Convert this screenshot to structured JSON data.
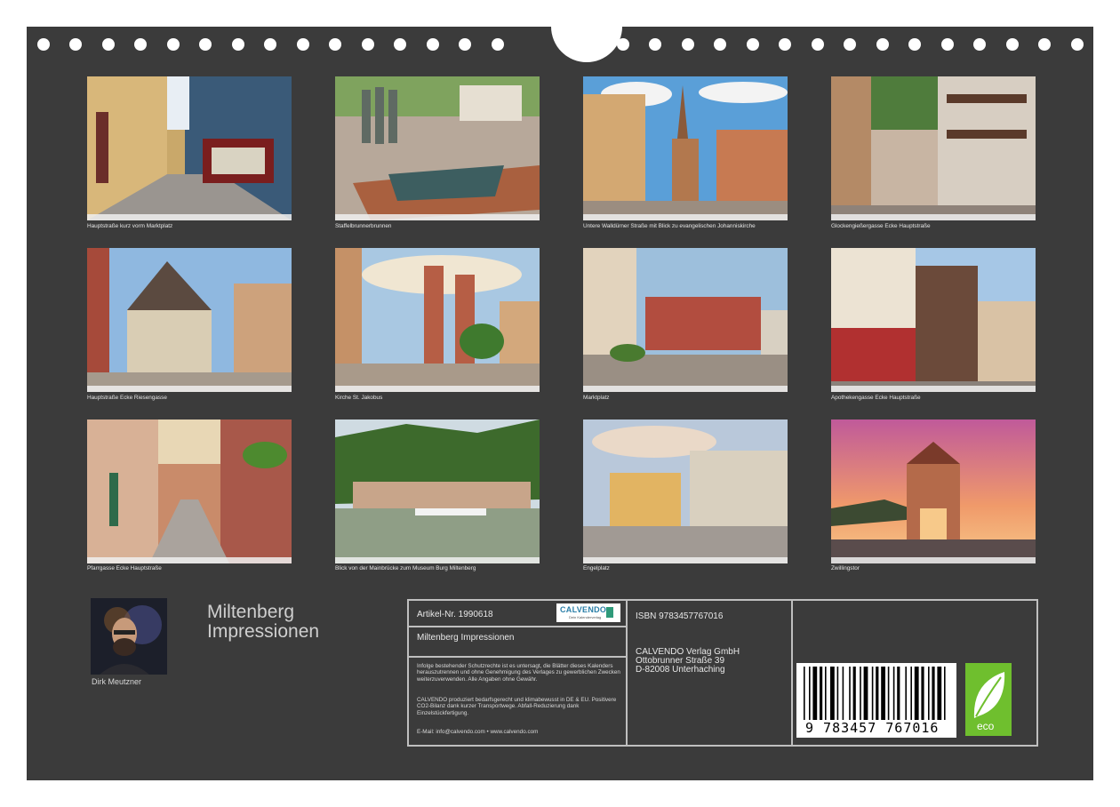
{
  "captions": [
    "Hauptstraße kurz vorm Marktplatz",
    "Staffelbrunnerbrunnen",
    "Untere Walldürner Straße mit Blick zu evangelischen Johanniskirche",
    "Glockengießergasse Ecke Hauptstraße",
    "Hauptstraße Ecke Riesengasse",
    "Kirche St. Jakobus",
    "Marktplatz",
    "Apothekengasse Ecke Hauptstraße",
    "Pfarrgasse Ecke Hauptstraße",
    "Blick von der Mainbrücke zum Museum Burg Miltenberg",
    "Engelplatz",
    "Zwillingstor"
  ],
  "title": {
    "line1": "Miltenberg",
    "line2": "Impressionen"
  },
  "author": "Dirk Meutzner",
  "info": {
    "article": "Artikel-Nr. 1990618",
    "logo": "CALVENDO",
    "logo_sub": "Dein Kalenderverlag",
    "product_name": "Miltenberg Impressionen",
    "legal1": "Infolge bestehender Schutzrechte ist es untersagt, die Blätter dieses Kalenders herauszutrennen und ohne Genehmigung des Verlages zu gewerblichen Zwecken weiterzuverwenden. Alle Angaben ohne Gewähr.",
    "legal2": "CALVENDO produziert bedarfsgerecht und klimabewusst in DE & EU. Positivere CO2-Bilanz dank kurzer Transportwege. Abfall-Reduzierung dank Einzelstückfertigung.",
    "contact": "E-Mail: info@calvendo.com • www.calvendo.com",
    "isbn": "ISBN 9783457767016",
    "publisher1": "CALVENDO Verlag GmbH",
    "publisher2": "Ottobrunner Straße 39",
    "publisher3": "D-82008 Unterhaching",
    "barcode_digits": "9 783457 767016",
    "eco_label": "eco"
  },
  "colors": {
    "board": "#3b3b3b",
    "eco_green": "#6fbf2e",
    "border": "#bfbfbf"
  }
}
